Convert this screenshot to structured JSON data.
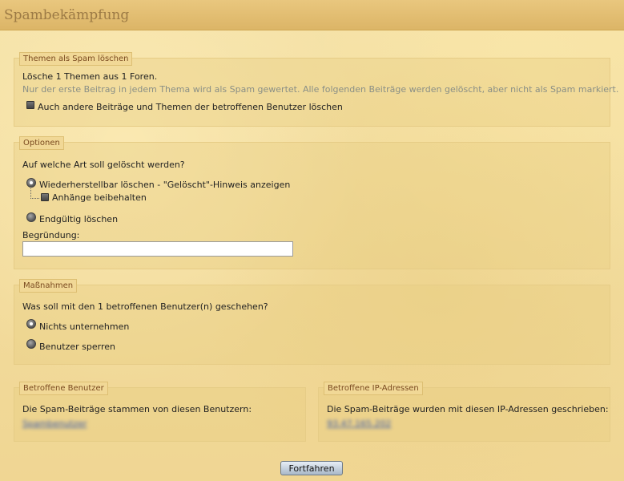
{
  "header": {
    "title": "Spambekämpfung"
  },
  "spam_panel": {
    "legend": "Themen als Spam löschen",
    "summary": "Lösche 1 Themen aus 1 Foren.",
    "note": "Nur der erste Beitrag in jedem Thema wird als Spam gewertet. Alle folgenden Beiträge werden gelöscht, aber nicht als Spam markiert.",
    "also_delete_label": "Auch andere Beiträge und Themen der betroffenen Benutzer löschen"
  },
  "options": {
    "legend": "Optionen",
    "question": "Auf welche Art soll gelöscht werden?",
    "soft_delete_label": "Wiederherstellbar löschen - \"Gelöscht\"-Hinweis anzeigen",
    "keep_attachments_label": "Anhänge beibehalten",
    "hard_delete_label": "Endgültig löschen",
    "reason_label": "Begründung:",
    "reason_value": "",
    "selected": "soft"
  },
  "actions": {
    "legend": "Maßnahmen",
    "question": "Was soll mit den 1 betroffenen Benutzer(n) geschehen?",
    "nothing_label": "Nichts unternehmen",
    "ban_label": "Benutzer sperren",
    "selected": "nothing"
  },
  "users": {
    "legend": "Betroffene Benutzer",
    "text": "Die Spam-Beiträge stammen von diesen Benutzern:",
    "link": "Spambenutzer"
  },
  "ips": {
    "legend": "Betroffene IP-Adressen",
    "text": "Die Spam-Beiträge wurden mit diesen IP-Adressen geschrieben:",
    "link": "93.47.165.202"
  },
  "submit": {
    "label": "Fortfahren"
  }
}
